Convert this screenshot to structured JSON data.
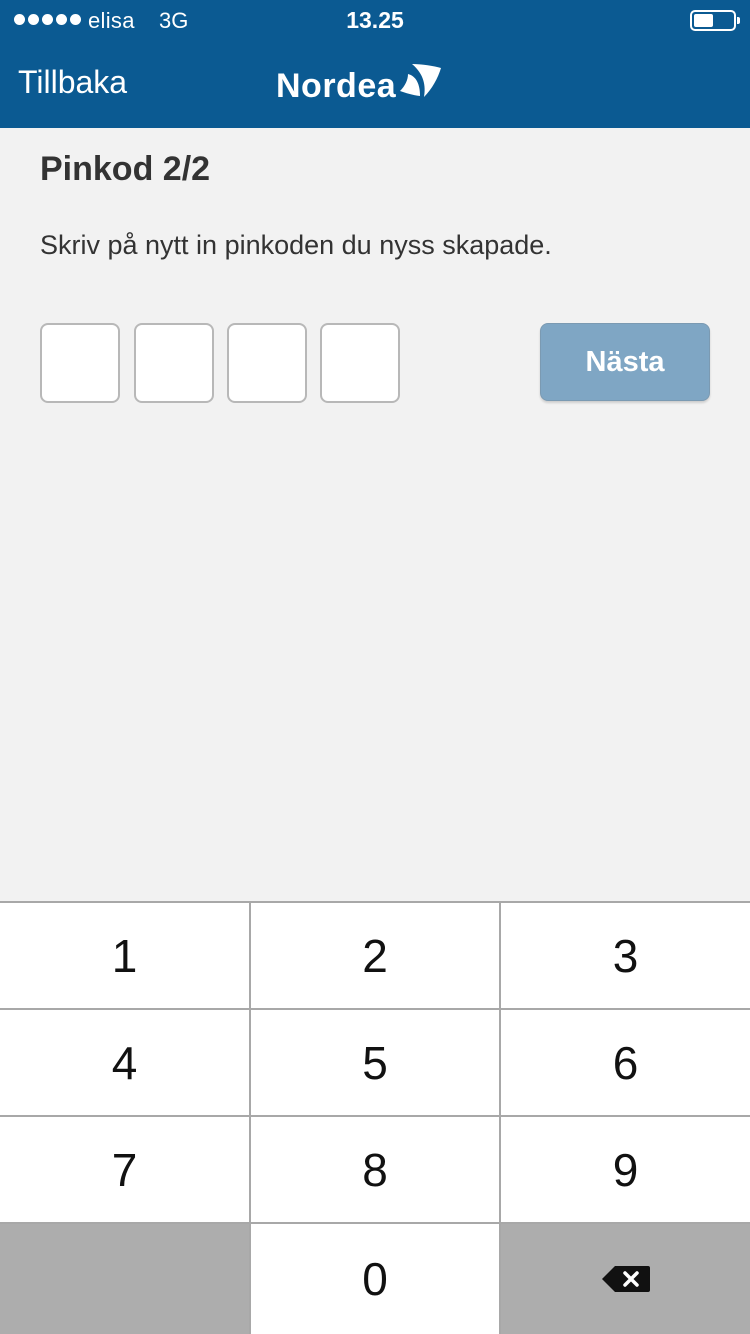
{
  "status_bar": {
    "carrier": "elisa",
    "network": "3G",
    "time": "13.25",
    "battery_level": 0.5
  },
  "nav": {
    "back_label": "Tillbaka",
    "logo_text": "Nordea"
  },
  "content": {
    "title": "Pinkod 2/2",
    "instruction": "Skriv på nytt in pinkoden du nyss skapade.",
    "pin_digits": [
      "",
      "",
      "",
      ""
    ],
    "next_label": "Nästa"
  },
  "keypad": {
    "keys": [
      "1",
      "2",
      "3",
      "4",
      "5",
      "6",
      "7",
      "8",
      "9",
      "",
      "0",
      "delete"
    ]
  },
  "colors": {
    "brand_blue": "#0b5a92",
    "next_button": "#7fa6c4",
    "background": "#f2f2f2"
  }
}
